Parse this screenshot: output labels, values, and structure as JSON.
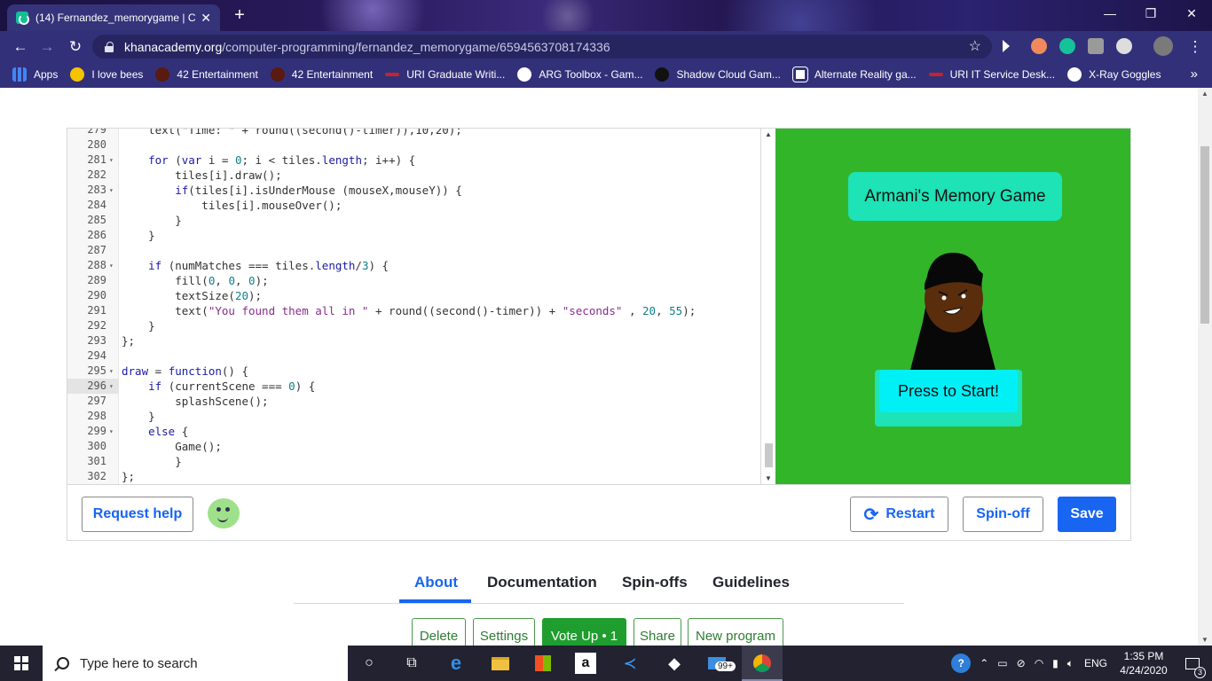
{
  "browser": {
    "tab_title": "(14) Fernandez_memorygame | C",
    "tab_close": "✕",
    "new_tab": "+",
    "window_buttons": [
      "—",
      "❐",
      "✕"
    ],
    "url_host": "khanacademy.org",
    "url_path": "/computer-programming/fernandez_memorygame/6594563708174336",
    "bookmarks": [
      {
        "label": "Apps",
        "icon": "apps-grid-icon",
        "color": "#4285f4"
      },
      {
        "label": "I love bees",
        "icon": "bee-icon",
        "color": "#f5c400"
      },
      {
        "label": "42 Entertainment",
        "icon": "star-icon",
        "color": "#b03020"
      },
      {
        "label": "42 Entertainment",
        "icon": "star-icon",
        "color": "#b03020"
      },
      {
        "label": "URI Graduate Writi...",
        "icon": "uri-icon",
        "color": "#c0262d"
      },
      {
        "label": "ARG Toolbox - Gam...",
        "icon": "soccer-icon",
        "color": "#ffffff"
      },
      {
        "label": "Shadow Cloud Gam...",
        "icon": "shadow-icon",
        "color": "#111111"
      },
      {
        "label": "Alternate Reality ga...",
        "icon": "window-icon",
        "color": "#ffffff"
      },
      {
        "label": "URI IT Service Desk...",
        "icon": "uri-icon",
        "color": "#c0262d"
      },
      {
        "label": "X-Ray Goggles",
        "icon": "goggles-icon",
        "color": "#ffffff"
      }
    ],
    "more": "»"
  },
  "editor": {
    "lines": [
      {
        "n": "279",
        "fold": "",
        "html": "    text(\"Time: \" + round((second()-timer)),10,20);"
      },
      {
        "n": "280",
        "fold": "",
        "html": ""
      },
      {
        "n": "281",
        "fold": "▾",
        "html": "    <span class=\"kw\">for</span> (<span class=\"kw\">var</span> i = <span class=\"num\">0</span>; i &lt; tiles.<span class=\"kw\">length</span>; i++) {"
      },
      {
        "n": "282",
        "fold": "",
        "html": "        tiles[i].draw();"
      },
      {
        "n": "283",
        "fold": "▾",
        "html": "        <span class=\"kw\">if</span>(tiles[i].isUnderMouse (mouseX,mouseY)) {"
      },
      {
        "n": "284",
        "fold": "",
        "html": "            tiles[i].mouseOver();"
      },
      {
        "n": "285",
        "fold": "",
        "html": "        }"
      },
      {
        "n": "286",
        "fold": "",
        "html": "    }"
      },
      {
        "n": "287",
        "fold": "",
        "html": ""
      },
      {
        "n": "288",
        "fold": "▾",
        "html": "    <span class=\"kw\">if</span> (numMatches === tiles.<span class=\"kw\">length</span>/<span class=\"num\">3</span>) {"
      },
      {
        "n": "289",
        "fold": "",
        "html": "        fill(<span class=\"num\">0</span>, <span class=\"num\">0</span>, <span class=\"num\">0</span>);"
      },
      {
        "n": "290",
        "fold": "",
        "html": "        textSize(<span class=\"num\">20</span>);"
      },
      {
        "n": "291",
        "fold": "",
        "html": "        text(<span class=\"str\">\"You found them all in \"</span> + round((second()-timer)) + <span class=\"str\">\"seconds\"</span> , <span class=\"num\">20</span>, <span class=\"num\">55</span>);"
      },
      {
        "n": "292",
        "fold": "",
        "html": "    }"
      },
      {
        "n": "293",
        "fold": "",
        "html": "};"
      },
      {
        "n": "294",
        "fold": "",
        "html": ""
      },
      {
        "n": "295",
        "fold": "▾",
        "html": "<span class=\"kw\">draw</span> = <span class=\"kw\">function</span>() {"
      },
      {
        "n": "296",
        "fold": "▾",
        "html": "    <span class=\"kw\">if</span> (currentScene === <span class=\"num\">0</span>) {"
      },
      {
        "n": "297",
        "fold": "",
        "html": "        splashScene();"
      },
      {
        "n": "298",
        "fold": "",
        "html": "    }"
      },
      {
        "n": "299",
        "fold": "▾",
        "html": "    <span class=\"kw\">else</span> {"
      },
      {
        "n": "300",
        "fold": "",
        "html": "        Game();"
      },
      {
        "n": "301",
        "fold": "",
        "html": "        }"
      },
      {
        "n": "302",
        "fold": "",
        "html": "};"
      }
    ],
    "active_line": "296"
  },
  "canvas": {
    "title": "Armani's Memory Game",
    "start_button": "Press to Start!",
    "bg_color": "#33b52a"
  },
  "toolbar": {
    "request_help": "Request help",
    "restart": "Restart",
    "spinoff": "Spin-off",
    "save": "Save"
  },
  "tabs": [
    "About",
    "Documentation",
    "Spin-offs",
    "Guidelines"
  ],
  "active_tab": "About",
  "actions": {
    "delete": "Delete",
    "settings": "Settings",
    "vote": "Vote Up • 1",
    "share": "Share",
    "new_program": "New program"
  },
  "taskbar": {
    "search_placeholder": "Type here to search",
    "language": "ENG",
    "time": "1:35 PM",
    "date": "4/24/2020",
    "mail_badge": "99+",
    "notification_count": "3"
  }
}
